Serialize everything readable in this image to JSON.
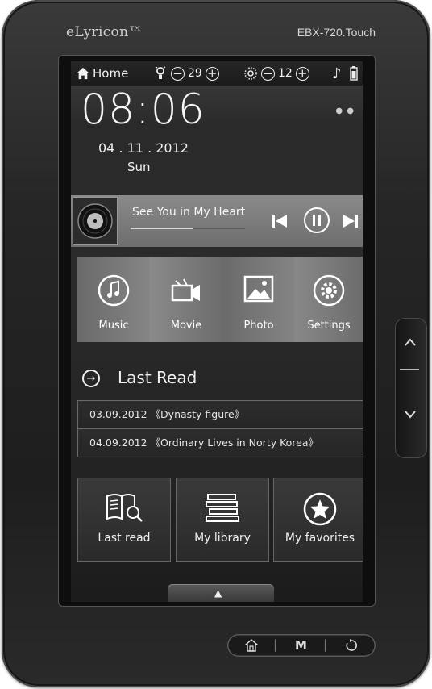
{
  "device": {
    "brand": "eLyricon™",
    "model": "EBX-720.Touch"
  },
  "statusbar": {
    "home_label": "Home",
    "bulb_value": "29",
    "brightness_value": "12"
  },
  "clock": {
    "time": "08:06",
    "date": "04 . 11 . 2012",
    "day": "Sun",
    "page_dots": "● ●"
  },
  "music": {
    "song_title": "See You in My Heart",
    "progress_fraction": 0.55
  },
  "apps": [
    {
      "label": "Music",
      "icon": "music-note-icon"
    },
    {
      "label": "Movie",
      "icon": "video-camera-icon"
    },
    {
      "label": "Photo",
      "icon": "photo-icon"
    },
    {
      "label": "Settings",
      "icon": "gear-icon"
    }
  ],
  "last_read": {
    "title": "Last Read",
    "items": [
      "03.09.2012 《Dynasty figure》",
      "04.09.2012 《Ordinary Lives  in Norty Korea》"
    ]
  },
  "tiles": [
    {
      "label": "Last read",
      "icon": "open-book-search-icon"
    },
    {
      "label": "My library",
      "icon": "books-stack-icon"
    },
    {
      "label": "My favorites",
      "icon": "star-icon"
    }
  ],
  "hardware_nav": {
    "home_icon": "home-outline-icon",
    "menu_label": "M",
    "back_icon": "rotate-icon"
  },
  "colors": {
    "bezel": "#262626",
    "screen_bg": "#2b2b2b",
    "music_bar": "#7c7c7c",
    "panel": "#6c6c6c"
  }
}
